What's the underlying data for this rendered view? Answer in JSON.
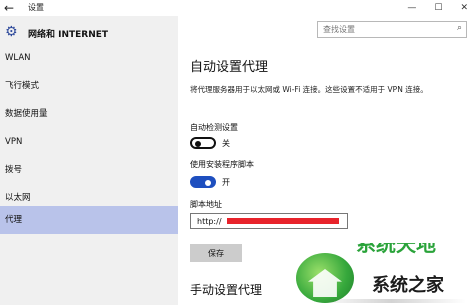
{
  "window": {
    "title": "设置",
    "controls": [
      "—",
      "☐",
      "✕"
    ]
  },
  "sidebar": {
    "header": "网络和 INTERNET",
    "items": [
      {
        "label": "WLAN"
      },
      {
        "label": "飞行模式"
      },
      {
        "label": "数据使用量"
      },
      {
        "label": "VPN"
      },
      {
        "label": "拨号"
      },
      {
        "label": "以太网"
      },
      {
        "label": "代理",
        "active": true
      }
    ]
  },
  "search": {
    "placeholder": "查找设置"
  },
  "auto_proxy": {
    "title": "自动设置代理",
    "description": "将代理服务器用于以太网或 Wi-Fi 连接。这些设置不适用于 VPN 连接。",
    "auto_detect": {
      "label": "自动检测设置",
      "state": "关",
      "on": false
    },
    "use_script": {
      "label": "使用安装程序脚本",
      "state": "开",
      "on": true
    },
    "script_address": {
      "label": "脚本地址",
      "value": "http://"
    },
    "save_label": "保存"
  },
  "manual_proxy": {
    "title": "手动设置代理"
  },
  "watermark": {
    "text": "系统之家",
    "partial_text": "系统天地"
  },
  "colors": {
    "accent": "#1e4fbf",
    "sidebar_bg": "#f0f0f0",
    "sidebar_active": "#b9c3ea",
    "redaction": "#e8232b"
  }
}
